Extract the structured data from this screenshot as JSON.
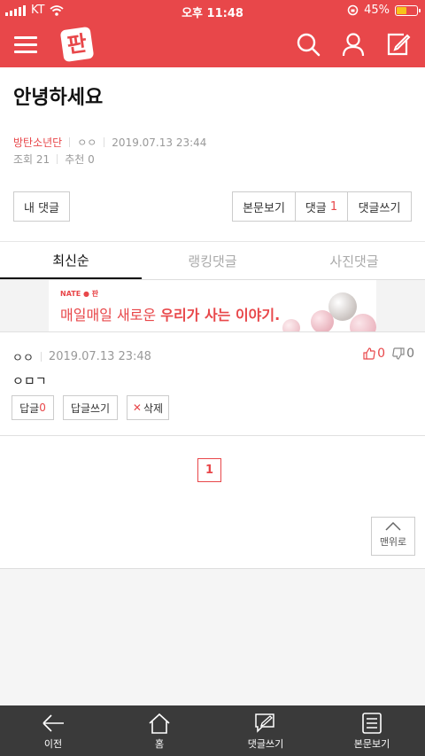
{
  "status_bar": {
    "carrier": "KT",
    "time": "오후 11:48",
    "battery_percent": "45%",
    "battery_level": 0.45
  },
  "header": {
    "logo_text": "판",
    "icons": [
      "menu-icon",
      "search-icon",
      "user-icon",
      "write-icon"
    ],
    "brand_color": "#e8474a"
  },
  "post": {
    "title": "안녕하세요",
    "author": "방탄소년단",
    "nickname": "ㅇㅇ",
    "datetime": "2019.07.13 23:44",
    "views_label": "조회",
    "views": "21",
    "recommend_label": "추천",
    "recommend": "0"
  },
  "actions": {
    "my_comments": "내 댓글",
    "view_post": "본문보기",
    "comments_label": "댓글",
    "comments_count": "1",
    "write_comment": "댓글쓰기"
  },
  "tabs": [
    {
      "label": "최신순",
      "active": true
    },
    {
      "label": "랭킹댓글",
      "active": false
    },
    {
      "label": "사진댓글",
      "active": false
    }
  ],
  "banner": {
    "brand": "NATE",
    "brand_sub": "판",
    "text_plain": "매일매일 새로운 ",
    "text_bold": "우리가 사는 이야기."
  },
  "comment": {
    "nickname": "ㅇㅇ",
    "datetime": "2019.07.13 23:48",
    "body": "ㅇㅁㄱ",
    "likes": "0",
    "dislikes": "0",
    "reply_label": "답글",
    "reply_count": "0",
    "write_reply": "답글쓰기",
    "delete_label": "삭제"
  },
  "pagination": {
    "current_page": "1"
  },
  "to_top_label": "맨위로",
  "bottom_nav": [
    {
      "label": "이전",
      "icon": "back-arrow-icon"
    },
    {
      "label": "홈",
      "icon": "home-icon"
    },
    {
      "label": "댓글쓰기",
      "icon": "comment-write-icon"
    },
    {
      "label": "본문보기",
      "icon": "document-icon"
    }
  ]
}
